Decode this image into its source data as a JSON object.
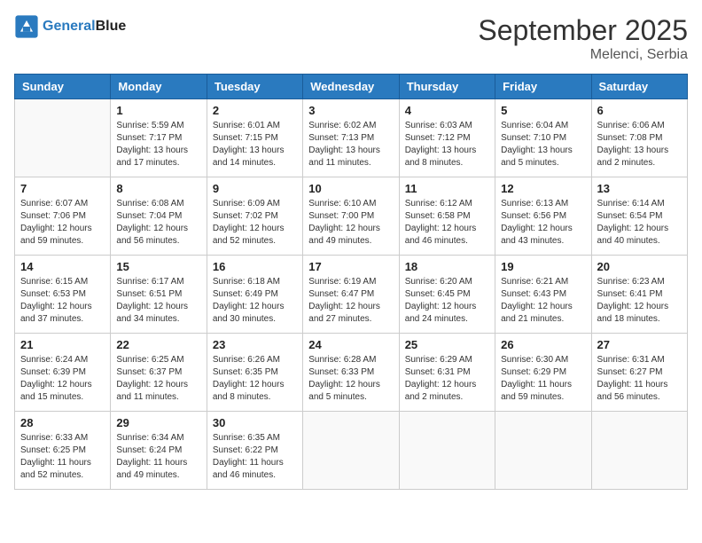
{
  "logo": {
    "line1": "General",
    "line2": "Blue"
  },
  "title": "September 2025",
  "location": "Melenci, Serbia",
  "days_header": [
    "Sunday",
    "Monday",
    "Tuesday",
    "Wednesday",
    "Thursday",
    "Friday",
    "Saturday"
  ],
  "weeks": [
    [
      {
        "num": "",
        "info": ""
      },
      {
        "num": "1",
        "info": "Sunrise: 5:59 AM\nSunset: 7:17 PM\nDaylight: 13 hours\nand 17 minutes."
      },
      {
        "num": "2",
        "info": "Sunrise: 6:01 AM\nSunset: 7:15 PM\nDaylight: 13 hours\nand 14 minutes."
      },
      {
        "num": "3",
        "info": "Sunrise: 6:02 AM\nSunset: 7:13 PM\nDaylight: 13 hours\nand 11 minutes."
      },
      {
        "num": "4",
        "info": "Sunrise: 6:03 AM\nSunset: 7:12 PM\nDaylight: 13 hours\nand 8 minutes."
      },
      {
        "num": "5",
        "info": "Sunrise: 6:04 AM\nSunset: 7:10 PM\nDaylight: 13 hours\nand 5 minutes."
      },
      {
        "num": "6",
        "info": "Sunrise: 6:06 AM\nSunset: 7:08 PM\nDaylight: 13 hours\nand 2 minutes."
      }
    ],
    [
      {
        "num": "7",
        "info": "Sunrise: 6:07 AM\nSunset: 7:06 PM\nDaylight: 12 hours\nand 59 minutes."
      },
      {
        "num": "8",
        "info": "Sunrise: 6:08 AM\nSunset: 7:04 PM\nDaylight: 12 hours\nand 56 minutes."
      },
      {
        "num": "9",
        "info": "Sunrise: 6:09 AM\nSunset: 7:02 PM\nDaylight: 12 hours\nand 52 minutes."
      },
      {
        "num": "10",
        "info": "Sunrise: 6:10 AM\nSunset: 7:00 PM\nDaylight: 12 hours\nand 49 minutes."
      },
      {
        "num": "11",
        "info": "Sunrise: 6:12 AM\nSunset: 6:58 PM\nDaylight: 12 hours\nand 46 minutes."
      },
      {
        "num": "12",
        "info": "Sunrise: 6:13 AM\nSunset: 6:56 PM\nDaylight: 12 hours\nand 43 minutes."
      },
      {
        "num": "13",
        "info": "Sunrise: 6:14 AM\nSunset: 6:54 PM\nDaylight: 12 hours\nand 40 minutes."
      }
    ],
    [
      {
        "num": "14",
        "info": "Sunrise: 6:15 AM\nSunset: 6:53 PM\nDaylight: 12 hours\nand 37 minutes."
      },
      {
        "num": "15",
        "info": "Sunrise: 6:17 AM\nSunset: 6:51 PM\nDaylight: 12 hours\nand 34 minutes."
      },
      {
        "num": "16",
        "info": "Sunrise: 6:18 AM\nSunset: 6:49 PM\nDaylight: 12 hours\nand 30 minutes."
      },
      {
        "num": "17",
        "info": "Sunrise: 6:19 AM\nSunset: 6:47 PM\nDaylight: 12 hours\nand 27 minutes."
      },
      {
        "num": "18",
        "info": "Sunrise: 6:20 AM\nSunset: 6:45 PM\nDaylight: 12 hours\nand 24 minutes."
      },
      {
        "num": "19",
        "info": "Sunrise: 6:21 AM\nSunset: 6:43 PM\nDaylight: 12 hours\nand 21 minutes."
      },
      {
        "num": "20",
        "info": "Sunrise: 6:23 AM\nSunset: 6:41 PM\nDaylight: 12 hours\nand 18 minutes."
      }
    ],
    [
      {
        "num": "21",
        "info": "Sunrise: 6:24 AM\nSunset: 6:39 PM\nDaylight: 12 hours\nand 15 minutes."
      },
      {
        "num": "22",
        "info": "Sunrise: 6:25 AM\nSunset: 6:37 PM\nDaylight: 12 hours\nand 11 minutes."
      },
      {
        "num": "23",
        "info": "Sunrise: 6:26 AM\nSunset: 6:35 PM\nDaylight: 12 hours\nand 8 minutes."
      },
      {
        "num": "24",
        "info": "Sunrise: 6:28 AM\nSunset: 6:33 PM\nDaylight: 12 hours\nand 5 minutes."
      },
      {
        "num": "25",
        "info": "Sunrise: 6:29 AM\nSunset: 6:31 PM\nDaylight: 12 hours\nand 2 minutes."
      },
      {
        "num": "26",
        "info": "Sunrise: 6:30 AM\nSunset: 6:29 PM\nDaylight: 11 hours\nand 59 minutes."
      },
      {
        "num": "27",
        "info": "Sunrise: 6:31 AM\nSunset: 6:27 PM\nDaylight: 11 hours\nand 56 minutes."
      }
    ],
    [
      {
        "num": "28",
        "info": "Sunrise: 6:33 AM\nSunset: 6:25 PM\nDaylight: 11 hours\nand 52 minutes."
      },
      {
        "num": "29",
        "info": "Sunrise: 6:34 AM\nSunset: 6:24 PM\nDaylight: 11 hours\nand 49 minutes."
      },
      {
        "num": "30",
        "info": "Sunrise: 6:35 AM\nSunset: 6:22 PM\nDaylight: 11 hours\nand 46 minutes."
      },
      {
        "num": "",
        "info": ""
      },
      {
        "num": "",
        "info": ""
      },
      {
        "num": "",
        "info": ""
      },
      {
        "num": "",
        "info": ""
      }
    ]
  ]
}
